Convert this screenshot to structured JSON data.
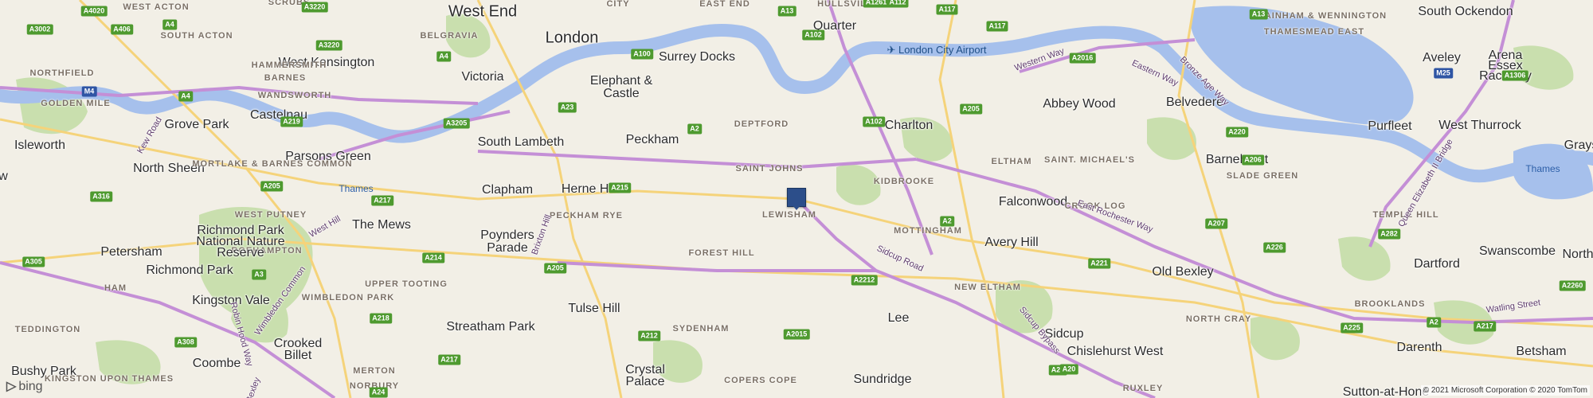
{
  "map": {
    "places": [
      {
        "name": "West End",
        "kind": "major"
      },
      {
        "name": "London",
        "kind": "major"
      },
      {
        "name": "Victoria",
        "kind": "place"
      },
      {
        "name": "West Kensington",
        "kind": "place"
      },
      {
        "name": "Elephant &",
        "kind": "place"
      },
      {
        "name": "Castle",
        "kind": "place"
      },
      {
        "name": "Surrey Docks",
        "kind": "place"
      },
      {
        "name": "Quarter",
        "kind": "place"
      },
      {
        "name": "South Ockendon",
        "kind": "place"
      },
      {
        "name": "Isleworth",
        "kind": "place"
      },
      {
        "name": "Grove Park",
        "kind": "place"
      },
      {
        "name": "Castelnau",
        "kind": "place"
      },
      {
        "name": "South Lambeth",
        "kind": "place"
      },
      {
        "name": "Parsons Green",
        "kind": "place"
      },
      {
        "name": "Peckham",
        "kind": "place"
      },
      {
        "name": "Charlton",
        "kind": "place"
      },
      {
        "name": "Abbey Wood",
        "kind": "place"
      },
      {
        "name": "Belvedere",
        "kind": "place"
      },
      {
        "name": "Aveley",
        "kind": "place"
      },
      {
        "name": "Purfleet",
        "kind": "place"
      },
      {
        "name": "West Thurrock",
        "kind": "place"
      },
      {
        "name": "Grays",
        "kind": "place"
      },
      {
        "name": "North Sheen",
        "kind": "place"
      },
      {
        "name": "Clapham",
        "kind": "place"
      },
      {
        "name": "Herne Hill",
        "kind": "place"
      },
      {
        "name": "Barnehurst",
        "kind": "place"
      },
      {
        "name": "Falconwood",
        "kind": "place"
      },
      {
        "name": "The Mews",
        "kind": "place"
      },
      {
        "name": "Poynders",
        "kind": "place"
      },
      {
        "name": "Parade",
        "kind": "place"
      },
      {
        "name": "Avery Hill",
        "kind": "place"
      },
      {
        "name": "Petersham",
        "kind": "place"
      },
      {
        "name": "Swanscombe",
        "kind": "place"
      },
      {
        "name": "Northfl",
        "kind": "place"
      },
      {
        "name": "Dartford",
        "kind": "place"
      },
      {
        "name": "Old Bexley",
        "kind": "place"
      },
      {
        "name": "Kingston Vale",
        "kind": "place"
      },
      {
        "name": "Tulse Hill",
        "kind": "place"
      },
      {
        "name": "Lee",
        "kind": "place"
      },
      {
        "name": "Streatham Park",
        "kind": "place"
      },
      {
        "name": "Sidcup",
        "kind": "place"
      },
      {
        "name": "Darenth",
        "kind": "place"
      },
      {
        "name": "Betsham",
        "kind": "place"
      },
      {
        "name": "Crooked",
        "kind": "place"
      },
      {
        "name": "Billet",
        "kind": "place"
      },
      {
        "name": "Coombe",
        "kind": "place"
      },
      {
        "name": "Crystal",
        "kind": "place"
      },
      {
        "name": "Palace",
        "kind": "place"
      },
      {
        "name": "Chislehurst West",
        "kind": "place"
      },
      {
        "name": "Bushy Park",
        "kind": "place"
      },
      {
        "name": "Sundridge",
        "kind": "place"
      },
      {
        "name": "Sutton-at-Hone",
        "kind": "place"
      },
      {
        "name": "w",
        "kind": "place"
      }
    ],
    "districts": [
      "Scrubs",
      "West Acton",
      "South Acton",
      "Belgravia",
      "City",
      "East End",
      "Hullsville",
      "Thamesmead East",
      "Rainham & Wennington",
      "Northfield",
      "Golden Mile",
      "Hammersmith",
      "Barnes",
      "Wandsworth",
      "Deptford",
      "Saint Johns",
      "Lewisham",
      "Eltham",
      "Saint. Michael's",
      "Kidbrooke",
      "Mortlake & Barnes Common",
      "Slade Green",
      "Temple Hill",
      "West Putney",
      "Roehampton",
      "Peckham Rye",
      "Crook Log",
      "Forest Hill",
      "Mottingham",
      "Ham",
      "Upper Tooting",
      "Wimbledon Park",
      "New Eltham",
      "Brooklands",
      "Teddington",
      "North Cray",
      "Sydenham",
      "Merton",
      "Norbury",
      "Copers Cope",
      "Ruxley",
      "Kingston Upon Thames"
    ],
    "water_labels": [
      "Thames",
      "Thames"
    ],
    "park_labels": [
      "Richmond Park",
      "National Nature",
      "Reserve",
      "Richmond Park",
      "Arena",
      "Essex",
      "Raceway"
    ],
    "airport": {
      "name": "London City Airport",
      "icon": "airplane-icon"
    },
    "road_names": [
      "Western Way",
      "Eastern Way",
      "Bronze Age Way",
      "East Rochester Way",
      "Sidcup Road",
      "Sidcup Bypass",
      "Queen Elizabeth II Bridge",
      "Watling Street",
      "West Hill",
      "Brixton Hill",
      "Wimbledon Common",
      "Robin Hood Way",
      "Kew Road",
      "Bexley"
    ],
    "road_shields": [
      "A4020",
      "A3220",
      "A3002",
      "A406",
      "A4",
      "A3220",
      "A4",
      "A100",
      "A13",
      "A102",
      "A1261",
      "A112",
      "A117",
      "A117",
      "A13",
      "A1306",
      "M4",
      "A4",
      "A219",
      "A3205",
      "A23",
      "A2",
      "A102",
      "A2016",
      "A205",
      "A220",
      "A206",
      "A316",
      "A205",
      "A217",
      "A20",
      "A215",
      "A2",
      "A207",
      "A226",
      "A282",
      "A305",
      "A3",
      "A214",
      "A205",
      "A2212",
      "A221",
      "A218",
      "A308",
      "A217",
      "A2015",
      "A212",
      "A20",
      "A225",
      "A2",
      "A24",
      "A217",
      "A2260",
      "M25"
    ],
    "pin_label": "Lewisham location marker",
    "logo": "bing",
    "copyright": "© 2021 Microsoft Corporation © 2020 TomTom"
  },
  "colors": {
    "land": "#f2efe6",
    "water": "#a6c0ec",
    "park": "#c9dfae",
    "motorway": "#c48fd6",
    "road_major": "#f5d37a",
    "pin": "#2c4e8a"
  }
}
